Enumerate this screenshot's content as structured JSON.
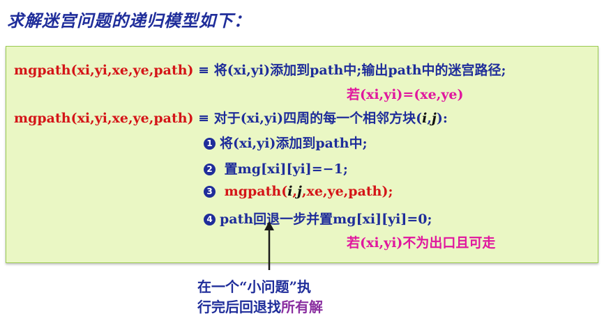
{
  "title": "求解迷宫问题的递归模型如下：",
  "rule1": {
    "lhs": "mgpath(xi,yi,xe,ye,path)",
    "equiv": " ≡ ",
    "rhs": "将(xi,yi)添加到path中;输出path中的迷宫路径;",
    "condition": "若(xi,yi)=(xe,ye)"
  },
  "rule2": {
    "lhs": "mgpath(xi,yi,xe,ye,path)",
    "equiv": " ≡ ",
    "rhs_prefix": "对于(xi,yi)四周的每一个相邻方块(",
    "rhs_i": "i",
    "rhs_comma": ",",
    "rhs_j": "j",
    "rhs_suffix": "):",
    "steps": [
      {
        "num": "1",
        "text": "将(xi,yi)添加到path中;"
      },
      {
        "num": "2",
        "text": " 置mg[xi][yi]=−1;"
      },
      {
        "num": "3",
        "text_prefix": " mgpath(",
        "i": "i",
        "comma": ",",
        "j": "j",
        "text_suffix": ",xe,ye,path);"
      },
      {
        "num": "4",
        "text": "path回退一步并置mg[xi][yi]=0;"
      }
    ],
    "condition": "若(xi,yi)不为出口且可走"
  },
  "note": {
    "line1": "在一个“小问题”执",
    "line2_prefix": "行完后回退找",
    "line2_highlight": "所有解"
  }
}
